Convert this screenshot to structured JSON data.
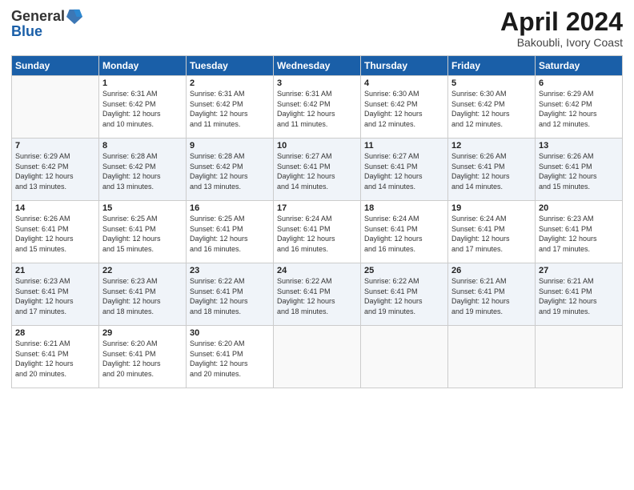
{
  "header": {
    "logo_general": "General",
    "logo_blue": "Blue",
    "month_title": "April 2024",
    "location": "Bakoubli, Ivory Coast"
  },
  "days_of_week": [
    "Sunday",
    "Monday",
    "Tuesday",
    "Wednesday",
    "Thursday",
    "Friday",
    "Saturday"
  ],
  "weeks": [
    [
      {
        "day": "",
        "info": ""
      },
      {
        "day": "1",
        "info": "Sunrise: 6:31 AM\nSunset: 6:42 PM\nDaylight: 12 hours\nand 10 minutes."
      },
      {
        "day": "2",
        "info": "Sunrise: 6:31 AM\nSunset: 6:42 PM\nDaylight: 12 hours\nand 11 minutes."
      },
      {
        "day": "3",
        "info": "Sunrise: 6:31 AM\nSunset: 6:42 PM\nDaylight: 12 hours\nand 11 minutes."
      },
      {
        "day": "4",
        "info": "Sunrise: 6:30 AM\nSunset: 6:42 PM\nDaylight: 12 hours\nand 12 minutes."
      },
      {
        "day": "5",
        "info": "Sunrise: 6:30 AM\nSunset: 6:42 PM\nDaylight: 12 hours\nand 12 minutes."
      },
      {
        "day": "6",
        "info": "Sunrise: 6:29 AM\nSunset: 6:42 PM\nDaylight: 12 hours\nand 12 minutes."
      }
    ],
    [
      {
        "day": "7",
        "info": "Sunrise: 6:29 AM\nSunset: 6:42 PM\nDaylight: 12 hours\nand 13 minutes."
      },
      {
        "day": "8",
        "info": "Sunrise: 6:28 AM\nSunset: 6:42 PM\nDaylight: 12 hours\nand 13 minutes."
      },
      {
        "day": "9",
        "info": "Sunrise: 6:28 AM\nSunset: 6:42 PM\nDaylight: 12 hours\nand 13 minutes."
      },
      {
        "day": "10",
        "info": "Sunrise: 6:27 AM\nSunset: 6:41 PM\nDaylight: 12 hours\nand 14 minutes."
      },
      {
        "day": "11",
        "info": "Sunrise: 6:27 AM\nSunset: 6:41 PM\nDaylight: 12 hours\nand 14 minutes."
      },
      {
        "day": "12",
        "info": "Sunrise: 6:26 AM\nSunset: 6:41 PM\nDaylight: 12 hours\nand 14 minutes."
      },
      {
        "day": "13",
        "info": "Sunrise: 6:26 AM\nSunset: 6:41 PM\nDaylight: 12 hours\nand 15 minutes."
      }
    ],
    [
      {
        "day": "14",
        "info": "Sunrise: 6:26 AM\nSunset: 6:41 PM\nDaylight: 12 hours\nand 15 minutes."
      },
      {
        "day": "15",
        "info": "Sunrise: 6:25 AM\nSunset: 6:41 PM\nDaylight: 12 hours\nand 15 minutes."
      },
      {
        "day": "16",
        "info": "Sunrise: 6:25 AM\nSunset: 6:41 PM\nDaylight: 12 hours\nand 16 minutes."
      },
      {
        "day": "17",
        "info": "Sunrise: 6:24 AM\nSunset: 6:41 PM\nDaylight: 12 hours\nand 16 minutes."
      },
      {
        "day": "18",
        "info": "Sunrise: 6:24 AM\nSunset: 6:41 PM\nDaylight: 12 hours\nand 16 minutes."
      },
      {
        "day": "19",
        "info": "Sunrise: 6:24 AM\nSunset: 6:41 PM\nDaylight: 12 hours\nand 17 minutes."
      },
      {
        "day": "20",
        "info": "Sunrise: 6:23 AM\nSunset: 6:41 PM\nDaylight: 12 hours\nand 17 minutes."
      }
    ],
    [
      {
        "day": "21",
        "info": "Sunrise: 6:23 AM\nSunset: 6:41 PM\nDaylight: 12 hours\nand 17 minutes."
      },
      {
        "day": "22",
        "info": "Sunrise: 6:23 AM\nSunset: 6:41 PM\nDaylight: 12 hours\nand 18 minutes."
      },
      {
        "day": "23",
        "info": "Sunrise: 6:22 AM\nSunset: 6:41 PM\nDaylight: 12 hours\nand 18 minutes."
      },
      {
        "day": "24",
        "info": "Sunrise: 6:22 AM\nSunset: 6:41 PM\nDaylight: 12 hours\nand 18 minutes."
      },
      {
        "day": "25",
        "info": "Sunrise: 6:22 AM\nSunset: 6:41 PM\nDaylight: 12 hours\nand 19 minutes."
      },
      {
        "day": "26",
        "info": "Sunrise: 6:21 AM\nSunset: 6:41 PM\nDaylight: 12 hours\nand 19 minutes."
      },
      {
        "day": "27",
        "info": "Sunrise: 6:21 AM\nSunset: 6:41 PM\nDaylight: 12 hours\nand 19 minutes."
      }
    ],
    [
      {
        "day": "28",
        "info": "Sunrise: 6:21 AM\nSunset: 6:41 PM\nDaylight: 12 hours\nand 20 minutes."
      },
      {
        "day": "29",
        "info": "Sunrise: 6:20 AM\nSunset: 6:41 PM\nDaylight: 12 hours\nand 20 minutes."
      },
      {
        "day": "30",
        "info": "Sunrise: 6:20 AM\nSunset: 6:41 PM\nDaylight: 12 hours\nand 20 minutes."
      },
      {
        "day": "",
        "info": ""
      },
      {
        "day": "",
        "info": ""
      },
      {
        "day": "",
        "info": ""
      },
      {
        "day": "",
        "info": ""
      }
    ]
  ]
}
